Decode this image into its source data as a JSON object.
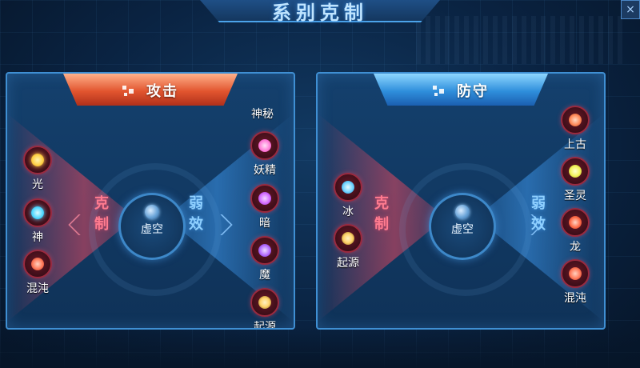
{
  "page_title": "系别克制",
  "close_glyph": "×",
  "attack": {
    "title": "攻击",
    "center": {
      "label": "虚空",
      "icon": "void-icon"
    },
    "strong_label": [
      "克",
      "制"
    ],
    "weak_label": [
      "弱",
      "效"
    ],
    "strong_against": [
      {
        "label": "光",
        "icon": "light-sun-icon",
        "color": "#ffd24a"
      },
      {
        "label": "神",
        "icon": "divine-icon",
        "color": "#4dd7ff"
      },
      {
        "label": "混沌",
        "icon": "chaos-icon",
        "color": "#ff7a5a"
      }
    ],
    "weak_against": [
      {
        "label": "神秘",
        "icon": "",
        "color": ""
      },
      {
        "label": "妖精",
        "icon": "fairy-icon",
        "color": "#ff78d6"
      },
      {
        "label": "暗",
        "icon": "dark-icon",
        "color": "#d56cff"
      },
      {
        "label": "魔",
        "icon": "demon-icon",
        "color": "#b46bff"
      },
      {
        "label": "起源",
        "icon": "origin-icon",
        "color": "#ffd36a"
      }
    ]
  },
  "defense": {
    "title": "防守",
    "center": {
      "label": "虚空",
      "icon": "void-icon"
    },
    "strong_label": [
      "克",
      "制"
    ],
    "weak_label": [
      "弱",
      "效"
    ],
    "strong_against": [
      {
        "label": "冰",
        "icon": "ice-icon",
        "color": "#6fd2ff"
      },
      {
        "label": "起源",
        "icon": "origin-icon",
        "color": "#ffd36a"
      }
    ],
    "weak_against": [
      {
        "label": "上古",
        "icon": "ancient-icon",
        "color": "#ff8a5a"
      },
      {
        "label": "圣灵",
        "icon": "holy-spirit-icon",
        "color": "#f3f25a"
      },
      {
        "label": "龙",
        "icon": "dragon-icon",
        "color": "#ff6d4a"
      },
      {
        "label": "混沌",
        "icon": "chaos-icon",
        "color": "#ff7a5a"
      }
    ]
  }
}
